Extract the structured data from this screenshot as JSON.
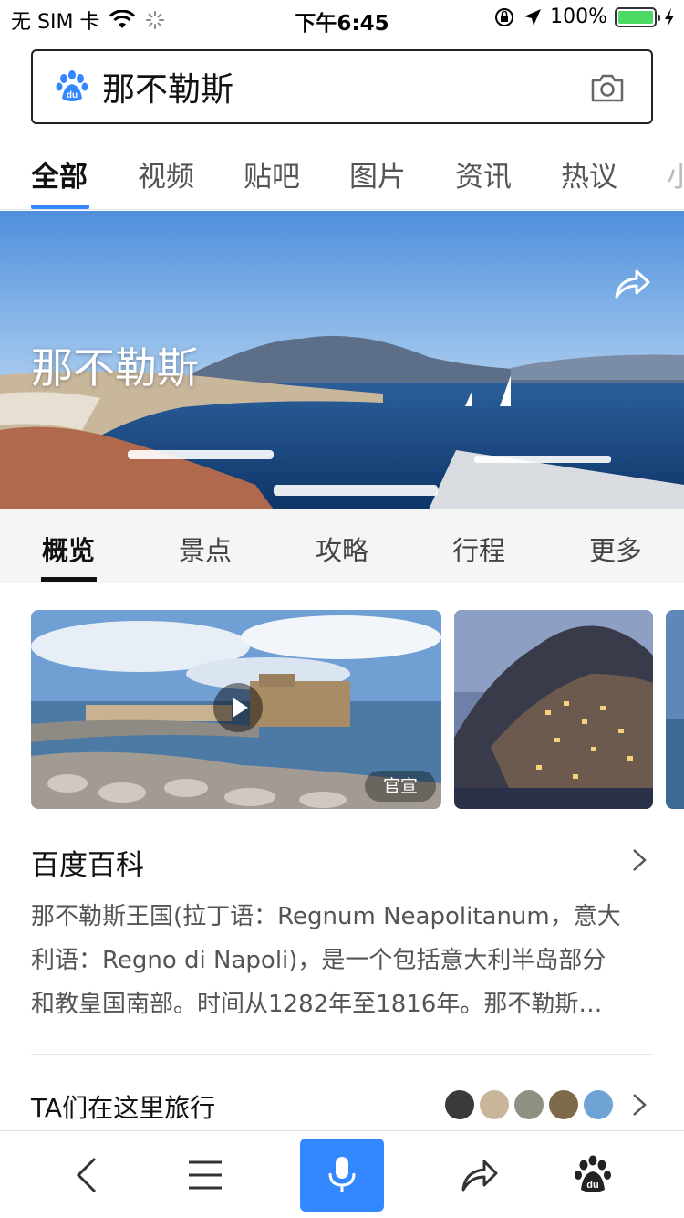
{
  "status_bar": {
    "carrier": "无 SIM 卡",
    "time": "下午6:45",
    "battery_percent": "100%",
    "battery_level": 1.0
  },
  "search": {
    "query": "那不勒斯"
  },
  "category_tabs": [
    {
      "label": "全部",
      "active": true
    },
    {
      "label": "视频",
      "active": false
    },
    {
      "label": "贴吧",
      "active": false
    },
    {
      "label": "图片",
      "active": false
    },
    {
      "label": "资讯",
      "active": false
    },
    {
      "label": "热议",
      "active": false
    },
    {
      "label": "小",
      "active": false
    }
  ],
  "hero": {
    "title": "那不勒斯"
  },
  "sub_tabs": [
    {
      "label": "概览",
      "active": true
    },
    {
      "label": "景点",
      "active": false
    },
    {
      "label": "攻略",
      "active": false
    },
    {
      "label": "行程",
      "active": false
    },
    {
      "label": "更多",
      "active": false
    }
  ],
  "media": {
    "video_badge": "官宣"
  },
  "baike": {
    "title": "百度百科",
    "lines": [
      "那不勒斯王国(拉丁语：Regnum Neapolitanum，意大",
      "利语：Regno di Napoli)，是一个包括意大利半岛部分",
      "和教皇国南部。时间从1282年至1816年。那不勒斯…"
    ]
  },
  "travel": {
    "label": "TA们在这里旅行"
  },
  "colors": {
    "accent": "#3388ff",
    "battery": "#4cd964"
  },
  "icons": [
    "wifi-icon",
    "loading-icon",
    "orientation-lock-icon",
    "location-arrow-icon",
    "charging-icon",
    "baidu-paw-icon",
    "camera-icon",
    "share-icon",
    "play-icon",
    "chevron-right-icon",
    "back-icon",
    "menu-icon",
    "microphone-icon"
  ]
}
